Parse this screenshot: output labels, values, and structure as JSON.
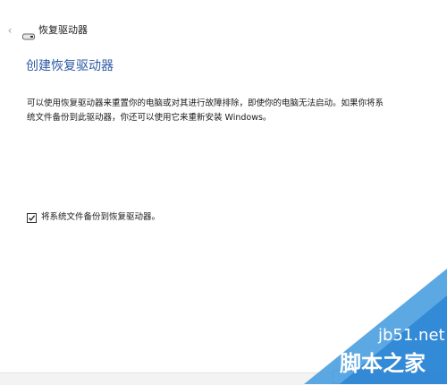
{
  "window": {
    "title": "恢复驱动器",
    "back_glyph": "‹"
  },
  "main": {
    "heading": "创建恢复驱动器",
    "description_lines": [
      "可以使用恢复驱动器来重置你的电脑或对其进行故障排除，即使你的电脑无法启动。如果你将系",
      "统文件备份到此驱动器，你还可以使用它来重新安装 Windows。"
    ],
    "backup_checkbox": {
      "label": "将系统文件备份到恢复驱动器。",
      "checked": true
    }
  },
  "watermark": {
    "site": "jb51.net",
    "name": "脚本之家"
  },
  "colors": {
    "heading": "#2e59a3",
    "watermark": "#4a9fe0"
  }
}
